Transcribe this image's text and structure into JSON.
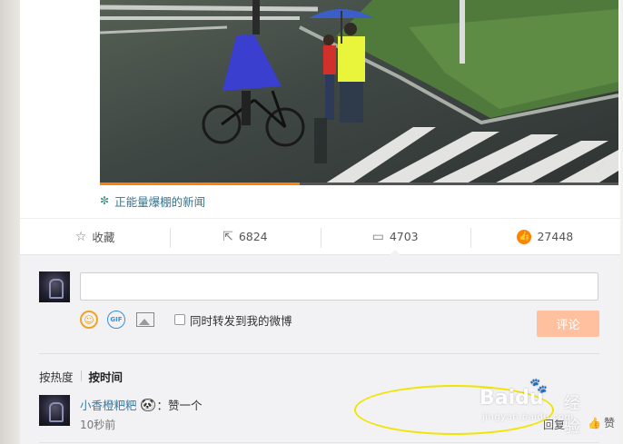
{
  "video": {
    "progress_fraction": 0.385,
    "corner_icon": "fullscreen-icon"
  },
  "source": {
    "icon": "flower-icon",
    "label": "正能量爆棚的新闻"
  },
  "actions": {
    "favorite_label": "收藏",
    "repost_count": "6824",
    "comment_count": "4703",
    "like_count": "27448"
  },
  "composer": {
    "input_value": "",
    "repost_label": "同时转发到我的微博",
    "submit_label": "评论",
    "submit_color": "#ffc09f"
  },
  "sort": {
    "hot_label": "按热度",
    "time_label": "按时间"
  },
  "comments": [
    {
      "user": "小香橙粑粑",
      "emoji": "panda-emoji",
      "text": "：赞一个",
      "time": "10秒前",
      "reply_label": "回复",
      "like_label": "赞"
    }
  ],
  "watermark": {
    "brand": "Bai",
    "brand_suffix": "du",
    "site": "经验",
    "url": "jingyan.baidu.com"
  },
  "colors": {
    "accent": "#ff8200",
    "link": "#3a7ba0",
    "annotation": "#f2e400"
  }
}
